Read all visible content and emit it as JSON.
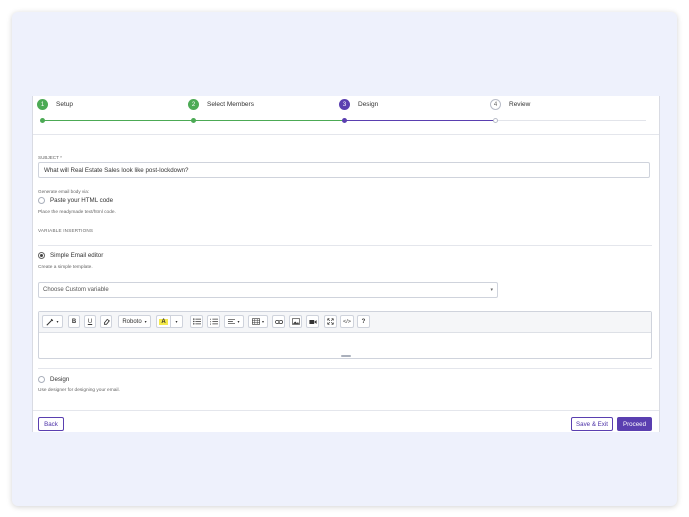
{
  "colors": {
    "done": "#4caa55",
    "active": "#5a3fb0",
    "pending_border": "#b8bcc8",
    "accent_highlight": "#f4e94a"
  },
  "steps": [
    {
      "number": "1",
      "label": "Setup",
      "state": "done"
    },
    {
      "number": "2",
      "label": "Select Members",
      "state": "done"
    },
    {
      "number": "3",
      "label": "Design",
      "state": "active"
    },
    {
      "number": "4",
      "label": "Review",
      "state": "pending"
    }
  ],
  "subject": {
    "label": "SUBJECT *",
    "value": "What will Real Estate Sales look like post-lockdown?"
  },
  "generate": {
    "label": "Generate email body via:",
    "html_option": "Paste your HTML code",
    "html_help": "Place the readymade text/html code.",
    "variable_insertions": "VARIABLE INSERTIONS",
    "simple_option": "Simple Email editor",
    "simple_help": "Create a simple template.",
    "design_option": "Design",
    "design_help": "Use designer for designing your email."
  },
  "custom_variable": {
    "placeholder": "Choose Custom variable"
  },
  "toolbar": {
    "bold": "B",
    "underline": "U",
    "font": "Roboto",
    "highlight": "A",
    "help": "?",
    "code": "</>"
  },
  "actions": {
    "back": "Back",
    "save_exit": "Save & Exit",
    "proceed": "Proceed"
  }
}
